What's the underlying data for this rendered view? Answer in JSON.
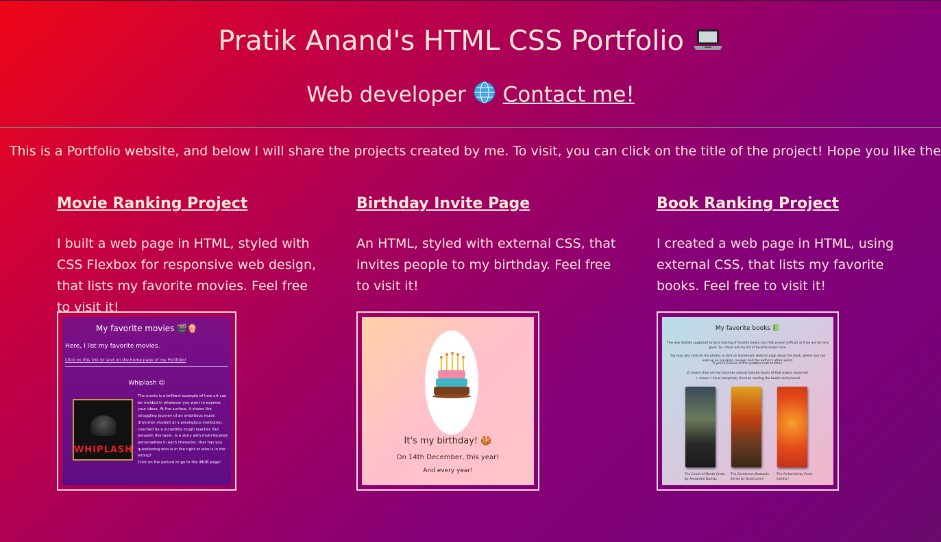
{
  "header": {
    "title": "Pratik Anand's HTML CSS Portfolio",
    "title_icon": "laptop-icon",
    "subtitle": "Web developer",
    "subtitle_icon": "globe-icon",
    "contact_link": "Contact me!"
  },
  "intro": "This is a Portfolio website, and below I will share the projects created by me. To visit, you can click on the title of the project! Hope you like them!",
  "projects": [
    {
      "title": "Movie Ranking Project",
      "description": "I built a web page in HTML, styled with CSS Flexbox for responsive web design, that lists my favorite movies. Feel free to visit it!",
      "thumbnail": {
        "heading": "My favorite movies",
        "subheading": "Here, I list my favorite movies.",
        "link": "Click on this link to land on the home page of my Portfolio!",
        "movie_title": "Whiplash",
        "poster_text": "WHIPLASH",
        "movie_desc": "The movie is a brilliant example of how art can be molded in whatever you want to express your ideas. At the surface, it shows the struggling journey of an ambitious music drummer student at a prestigious institution, coached by a incredibly tough teacher. But beneath this layer, is a story with multi-faceted personalities in each character, that has you questioning who is in the right or who is in the wrong?",
        "movie_link": "Click on the picture to go to the IMDB page!"
      }
    },
    {
      "title": "Birthday Invite Page",
      "description": "An HTML, styled with external CSS, that invites people to my birthday. Feel free to visit it!",
      "thumbnail": {
        "line1": "It's my birthday!",
        "line2": "On 14th December, this year!",
        "line3": "And every year!"
      }
    },
    {
      "title": "Book Ranking Project",
      "description": "I created a web page in HTML, using external CSS, that lists my favorite books. Feel free to visit it!",
      "thumbnail": {
        "heading": "My favorite books",
        "p1": "This was initially supposed to be a ranking of favorite books, but that proved difficult as they are all very good. So, check out my list of favorite books here.",
        "p2": "You may also click on the photos to land on Goodreads website page about the book, where you can read up on synopsis, reviews and the author's other works.",
        "p3": "If you're curious of the symbols next to titles:",
        "p4": "means they are my favorites among favorite books (if that makes sense lol).",
        "p5": "✓ means I have completely finished reading the books series/novel",
        "books": [
          {
            "caption": "The Count of Monte Cristo by Alexandre Dumas",
            "color": "#2c3a34"
          },
          {
            "caption": "The Gentlemen Bastards Series by Scott Lynch",
            "color": "#8a5a1a"
          },
          {
            "caption": "The Alchemist by Paulo Coelho✓",
            "color": "#e0401a"
          }
        ]
      }
    }
  ],
  "colors": {
    "text": "#fde8d8",
    "gradient_start": "#ee0716",
    "gradient_end": "#7a007a"
  }
}
